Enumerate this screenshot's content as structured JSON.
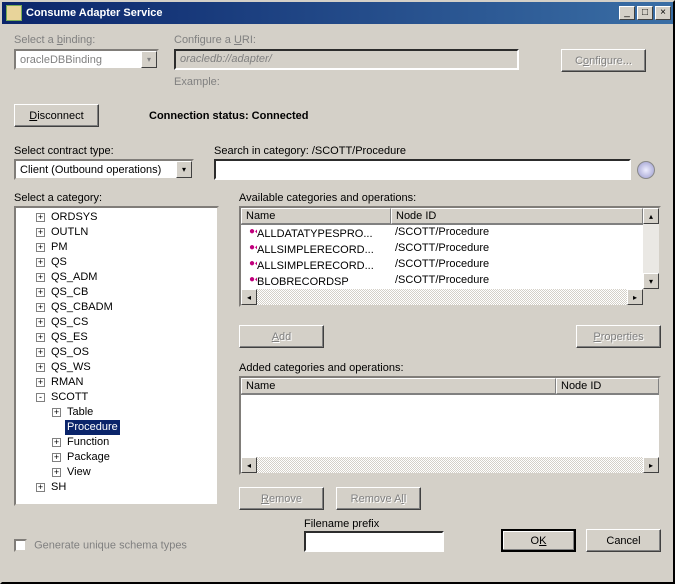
{
  "window": {
    "title": "Consume Adapter Service"
  },
  "binding": {
    "label_pre": "Select a ",
    "label_u": "b",
    "label_post": "inding:",
    "value": "oracleDBBinding"
  },
  "uri": {
    "label_pre": "Configure a ",
    "label_u": "U",
    "label_post": "RI:",
    "value": "oracledb://adapter/",
    "example_label": "Example:"
  },
  "configure_btn": {
    "pre": "C",
    "u": "o",
    "post": "nfigure..."
  },
  "disconnect_btn": {
    "u": "D",
    "post": "isconnect"
  },
  "status": {
    "label": "Connection status: ",
    "value": "Connected"
  },
  "contract": {
    "label": "Select contract type:",
    "value": "Client (Outbound operations)"
  },
  "search": {
    "label": "Search in category: /SCOTT/Procedure",
    "value": ""
  },
  "category_label": "Select a category:",
  "tree": [
    {
      "indent": 1,
      "exp": "+",
      "label": "ORDSYS"
    },
    {
      "indent": 1,
      "exp": "+",
      "label": "OUTLN"
    },
    {
      "indent": 1,
      "exp": "+",
      "label": "PM"
    },
    {
      "indent": 1,
      "exp": "+",
      "label": "QS"
    },
    {
      "indent": 1,
      "exp": "+",
      "label": "QS_ADM"
    },
    {
      "indent": 1,
      "exp": "+",
      "label": "QS_CB"
    },
    {
      "indent": 1,
      "exp": "+",
      "label": "QS_CBADM"
    },
    {
      "indent": 1,
      "exp": "+",
      "label": "QS_CS"
    },
    {
      "indent": 1,
      "exp": "+",
      "label": "QS_ES"
    },
    {
      "indent": 1,
      "exp": "+",
      "label": "QS_OS"
    },
    {
      "indent": 1,
      "exp": "+",
      "label": "QS_WS"
    },
    {
      "indent": 1,
      "exp": "+",
      "label": "RMAN"
    },
    {
      "indent": 1,
      "exp": "-",
      "label": "SCOTT"
    },
    {
      "indent": 2,
      "exp": "+",
      "label": "Table"
    },
    {
      "indent": 2,
      "exp": " ",
      "label": "Procedure",
      "selected": true
    },
    {
      "indent": 2,
      "exp": "+",
      "label": "Function"
    },
    {
      "indent": 2,
      "exp": "+",
      "label": "Package"
    },
    {
      "indent": 2,
      "exp": "+",
      "label": "View"
    },
    {
      "indent": 1,
      "exp": "+",
      "label": "SH"
    }
  ],
  "available": {
    "label": "Available categories and operations:",
    "cols": {
      "name": "Name",
      "node": "Node ID"
    },
    "rows": [
      {
        "name": "ALLDATATYPESPRO...",
        "node": "/SCOTT/Procedure"
      },
      {
        "name": "ALLSIMPLERECORD...",
        "node": "/SCOTT/Procedure"
      },
      {
        "name": "ALLSIMPLERECORD...",
        "node": "/SCOTT/Procedure"
      },
      {
        "name": "BLOBRECORDSP",
        "node": "/SCOTT/Procedure"
      }
    ]
  },
  "add_btn": {
    "u": "A",
    "post": "dd"
  },
  "properties_btn": {
    "u": "P",
    "post": "roperties"
  },
  "added": {
    "label": "Added categories and operations:",
    "cols": {
      "name": "Name",
      "node": "Node ID"
    }
  },
  "remove_btn": {
    "u": "R",
    "post": "emove"
  },
  "removeall_btn": {
    "pre": "Remove A",
    "u": "l",
    "post": "l"
  },
  "prefix_label": "Filename prefix",
  "gen_checkbox_label": "Generate unique schema types",
  "ok_btn": {
    "pre": "O",
    "u": "K"
  },
  "cancel_btn": "Cancel"
}
